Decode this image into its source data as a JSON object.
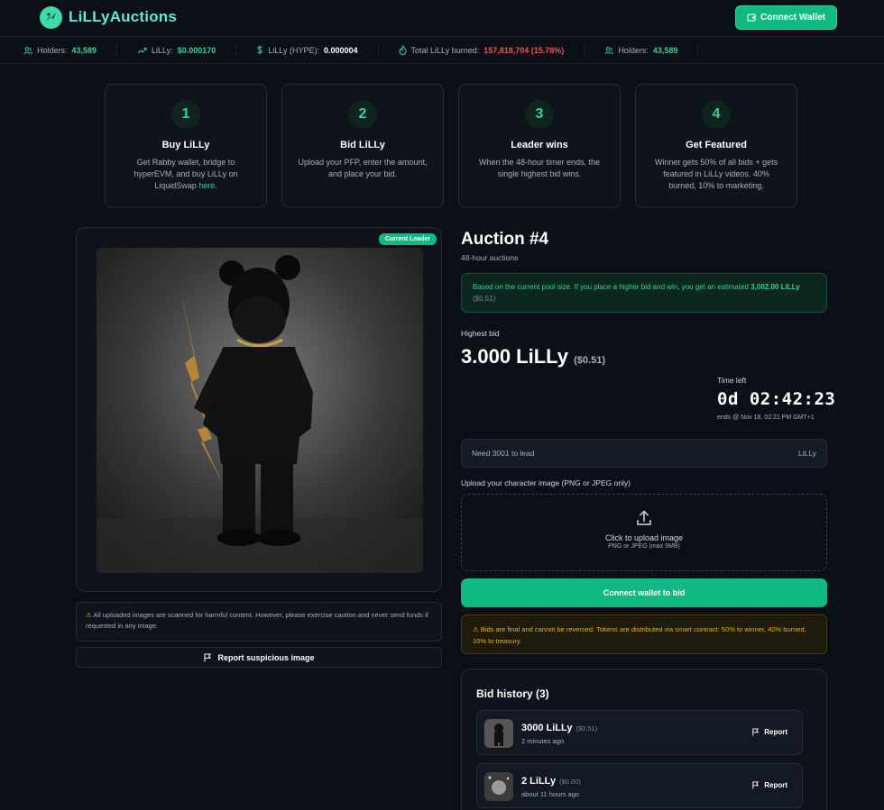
{
  "header": {
    "brand": "LiLLyAuctions",
    "connect_label": "Connect Wallet"
  },
  "ticker": [
    {
      "icon": "users-icon",
      "label": "Holders:",
      "value": "43,589",
      "color": "green"
    },
    {
      "icon": "trend-up-icon",
      "label": "LiLLy:",
      "value": "$0.000170",
      "color": "green"
    },
    {
      "icon": "dollar-icon",
      "label": "LiLLy (HYPE):",
      "value": "0.000004",
      "color": "white"
    },
    {
      "icon": "flame-icon",
      "label": "Total LiLLy burned:",
      "value": "157,818,704 (15.78%)",
      "color": "red"
    },
    {
      "icon": "users-icon",
      "label": "Holders:",
      "value": "43,589",
      "color": "green"
    }
  ],
  "steps": [
    {
      "num": "1",
      "title": "Buy LiLLy",
      "text": "Get Rabby wallet, bridge to hyperEVM, and buy LiLLy on LiquidSwap",
      "link": "here",
      "suffix": "."
    },
    {
      "num": "2",
      "title": "Bid LiLLy",
      "text": "Upload your PFP, enter the amount, and place your bid."
    },
    {
      "num": "3",
      "title": "Leader wins",
      "text": "When the 48-hour timer ends, the single highest bid wins."
    },
    {
      "num": "4",
      "title": "Get Featured",
      "text": "Winner gets 50% of all bids + gets featured in LiLLy videos. 40% burned, 10% to marketing."
    }
  ],
  "image_panel": {
    "badge": "Current Leader",
    "notice": "All uploaded images are scanned for harmful content. However, please exercise caution and never send funds if requested in any image.",
    "report_label": "Report suspicious image"
  },
  "auction": {
    "title": "Auction #4",
    "subtitle": "48-hour auctions",
    "estimate_text": "Based on the current pool size. If you place a higher bid and win, you get an estimated",
    "estimate_amount": "3,002.00 LiLLy",
    "estimate_usd": "($0.51)",
    "highest_bid_label": "Highest bid",
    "highest_bid_value": "3.000 LiLLy",
    "highest_bid_usd": "($0.51)",
    "time_left_label": "Time left",
    "time_left_value": "0d 02:42:23",
    "ends_text": "ends @ Nov 18, 02:21 PM GMT+1",
    "bid_input_placeholder": "Need 3001 to lead",
    "bid_input_unit": "LiLLy",
    "upload_label": "Upload your character image (PNG or JPEG only)",
    "upload_title": "Click to upload image",
    "upload_hint": "PNG or JPEG (max 5MB)",
    "bid_button": "Connect wallet to bid",
    "final_notice": "Bids are final and cannot be reversed. Tokens are distributed via smart contract: 50% to winner, 40% burned, 10% to treasury."
  },
  "history": {
    "title": "Bid history (3)",
    "report_label": "Report",
    "bids": [
      {
        "amount": "3000 LiLLy",
        "usd": "($0.51)",
        "time": "2 minutes ago"
      },
      {
        "amount": "2 LiLLy",
        "usd": "($0.00)",
        "time": "about 11 hours ago"
      }
    ]
  },
  "colors": {
    "accent": "#10b981",
    "accent_text": "#34d399",
    "burn": "#f05252",
    "warning": "#eab308",
    "background": "#0b0f17"
  }
}
